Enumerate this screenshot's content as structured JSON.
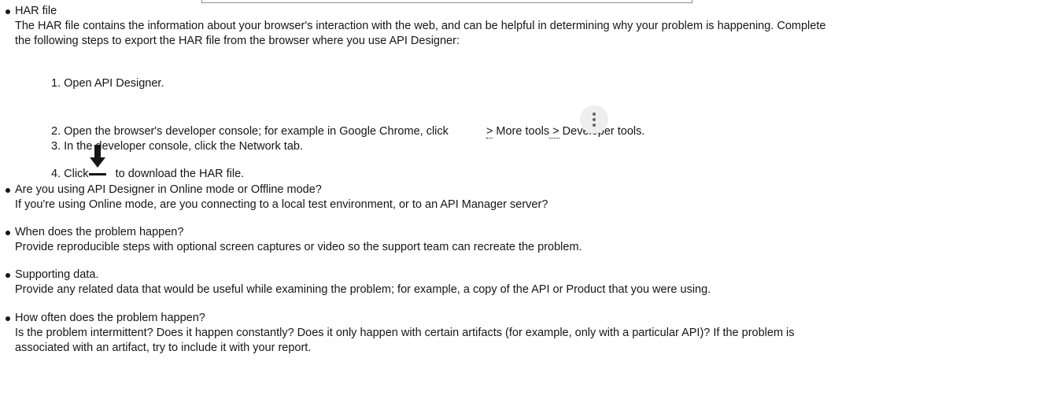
{
  "list": [
    {
      "title": "HAR file",
      "lines": [
        "The HAR file contains the information about your browser's interaction with the web, and can be helpful in determining why your problem is happening. Complete",
        "the following steps to export the HAR file from the browser where you use API Designer:"
      ],
      "steps": {
        "s1": "1. Open API Designer.",
        "s2_pre": "2. Open the browser's developer console; for example in Google Chrome, click",
        "s2_sep1": ">",
        "s2_mid": " More tools",
        "s2_sep2": " >",
        "s2_post": " Developer tools.",
        "s3": "3. In the developer console, click the Network tab.",
        "s4_pre": "4. Click",
        "s4_post": "to download the HAR file."
      }
    },
    {
      "title": "Are you using API Designer in Online mode or Offline mode?",
      "lines": [
        "If you're using Online mode, are you connecting to a local test environment, or to an API Manager server?"
      ]
    },
    {
      "title": "When does the problem happen?",
      "lines": [
        "Provide reproducible steps with optional screen captures or video so the support team can recreate the problem."
      ]
    },
    {
      "title": "Supporting data.",
      "lines": [
        "Provide any related data that would be useful while examining the problem; for example, a copy of the API or Product that you were using."
      ]
    },
    {
      "title": "How often does the problem happen?",
      "lines": [
        "Is the problem intermittent? Does it happen constantly? Does it only happen with certain artifacts (for example, only with a particular API)? If the problem is",
        "associated with an artifact, try to include it with your report."
      ]
    }
  ],
  "icons": {
    "menu": "more-vert-icon",
    "download": "download-icon"
  }
}
